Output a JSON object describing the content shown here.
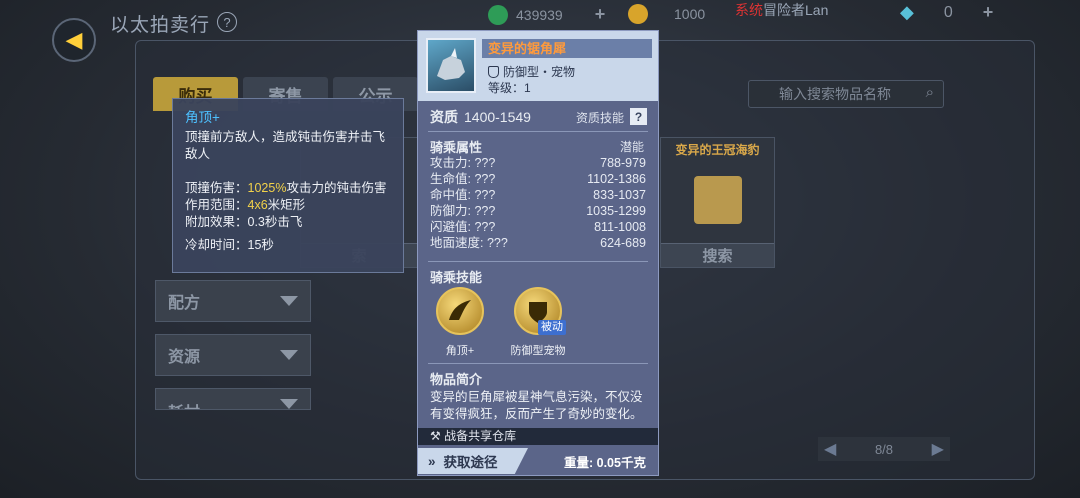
{
  "header": {
    "title": "以太拍卖行",
    "help_icon": "?",
    "currency_1": "439939",
    "currency_2": "1000",
    "currency_3": "0",
    "news_prefix": "系统",
    "news_text": "冒险者Lan",
    "news_count": "0"
  },
  "tabs": [
    "购买",
    "寄售",
    "公示"
  ],
  "search": {
    "placeholder": "输入搜索物品名称"
  },
  "categories": [
    "配方",
    "资源",
    "耗材"
  ],
  "cards": [
    {
      "title": "",
      "button": "索"
    },
    {
      "title": "变异的王冠海豹",
      "button": "搜索"
    }
  ],
  "pager": {
    "text": "8/8"
  },
  "skill_tooltip": {
    "name": "角顶+",
    "desc": "顶撞前方敌人，造成钝击伤害并击飞敌人",
    "damage_label": "顶撞伤害：",
    "damage_value": "1025%",
    "damage_suffix": "攻击力的钝击伤害",
    "range_label": "作用范围：",
    "range_value": "4x6",
    "range_suffix": "米矩形",
    "effect": "附加效果：0.3秒击飞",
    "cooldown": "冷却时间：15秒"
  },
  "item": {
    "name": "变异的锯角犀",
    "type": "防御型・宠物",
    "level": "等级：1",
    "quality_label": "资质",
    "quality_value": "1400-1549",
    "quality_skill": "资质技能",
    "quality_help": "?",
    "mount_attr_title": "骑乘属性",
    "potential_label": "潜能",
    "attributes": [
      {
        "label": "攻击力: ???",
        "value": "788-979"
      },
      {
        "label": "生命值: ???",
        "value": "1102-1386"
      },
      {
        "label": "命中值: ???",
        "value": "833-1037"
      },
      {
        "label": "防御力: ???",
        "value": "1035-1299"
      },
      {
        "label": "闪避值: ???",
        "value": "811-1008"
      },
      {
        "label": "地面速度: ???",
        "value": "624-689"
      }
    ],
    "mount_skill_title": "骑乘技能",
    "skills": [
      {
        "name": "角顶+",
        "icon": "horn-icon",
        "tag": ""
      },
      {
        "name": "防御型宠物",
        "icon": "shield-fist-icon",
        "tag": "被动"
      }
    ],
    "intro_title": "物品简介",
    "intro": "变异的巨角犀被星神气息污染，不仅没有变得疯狂，反而产生了奇妙的变化。",
    "warehouse": "战备共享仓库",
    "acquire_button": "获取途径",
    "weight": "重量: 0.05千克"
  },
  "colors": {
    "item_name": "#ff9a3c",
    "skill_name": "#4dc0ff",
    "highlight": "#f2d24a",
    "panel_bg": "#5b6589"
  }
}
